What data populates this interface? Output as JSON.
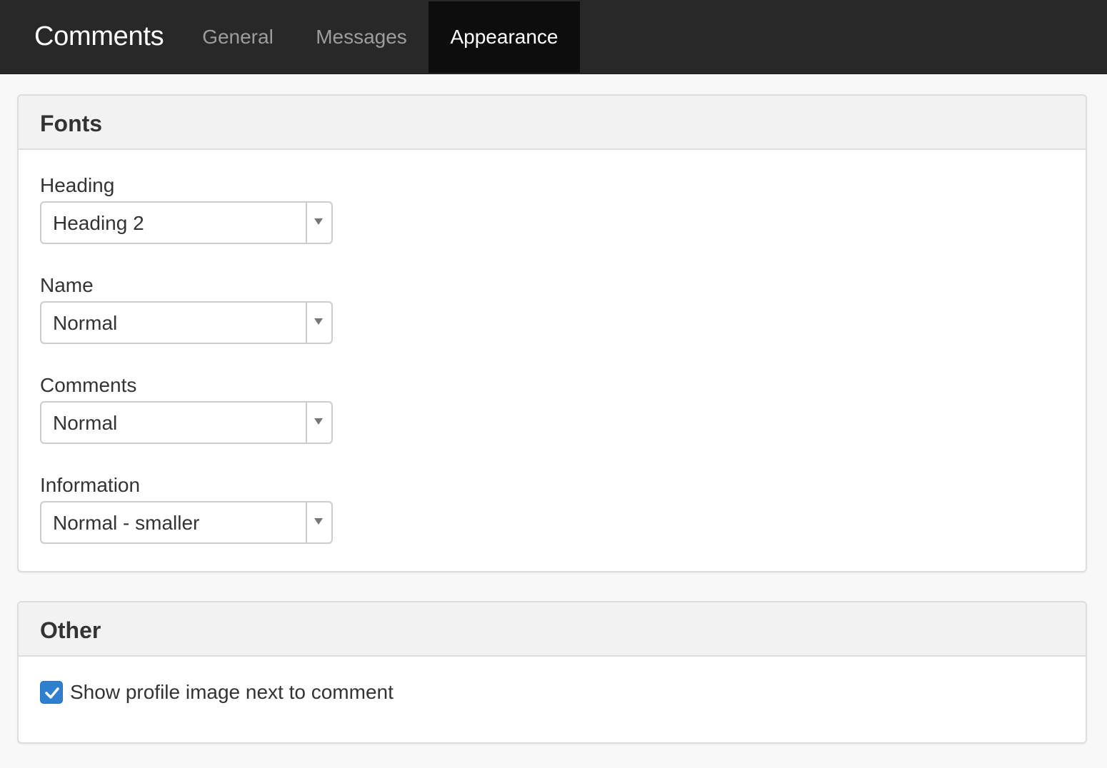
{
  "header": {
    "brand": "Comments",
    "tabs": [
      {
        "label": "General",
        "active": false
      },
      {
        "label": "Messages",
        "active": false
      },
      {
        "label": "Appearance",
        "active": true
      }
    ]
  },
  "fonts_panel": {
    "title": "Fonts",
    "fields": [
      {
        "label": "Heading",
        "value": "Heading 2"
      },
      {
        "label": "Name",
        "value": "Normal"
      },
      {
        "label": "Comments",
        "value": "Normal"
      },
      {
        "label": "Information",
        "value": "Normal - smaller"
      }
    ]
  },
  "other_panel": {
    "title": "Other",
    "show_profile_image": {
      "label": "Show profile image next to comment",
      "checked": true
    }
  },
  "colors": {
    "navbar": "#282828",
    "active_tab": "#0d0d0d",
    "checkbox": "#2f7fd1"
  },
  "icons": {
    "select_arrow": "caret-down-icon",
    "checkbox_check": "checkmark-icon"
  }
}
